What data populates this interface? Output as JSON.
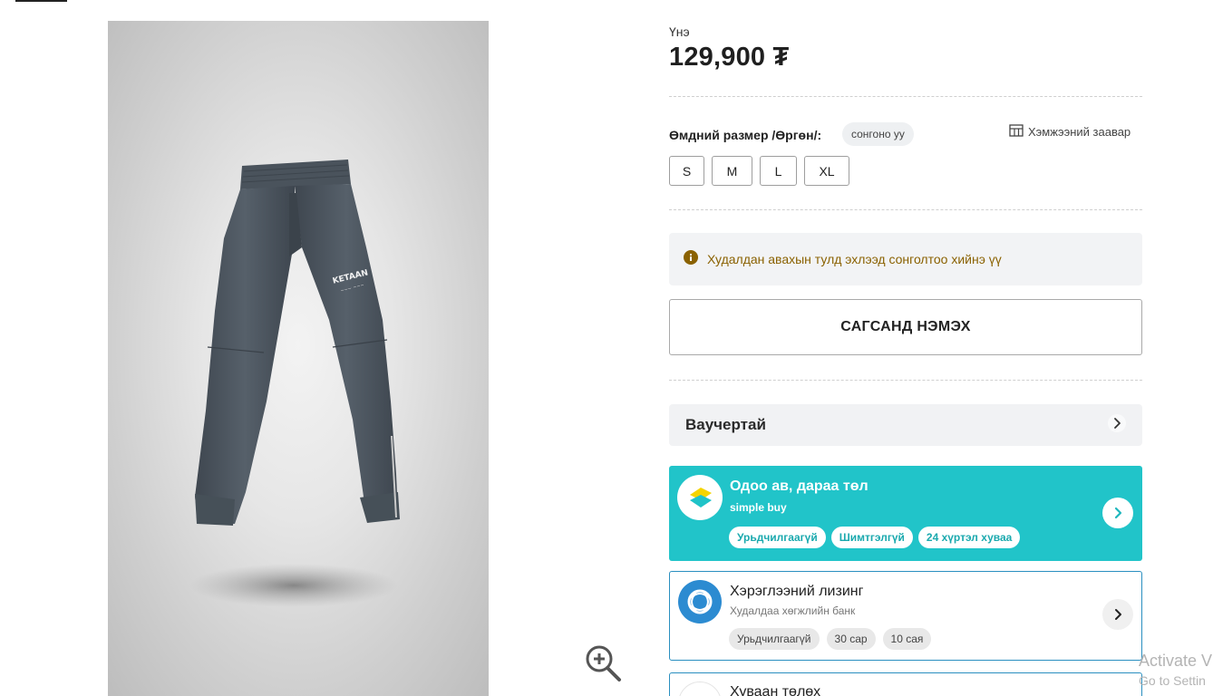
{
  "product": {
    "image_alt": "Гар цамцны өмд",
    "print_text": "KETAAN"
  },
  "price": {
    "label": "Үнэ",
    "value": "129,900 ₮"
  },
  "size": {
    "label": "Өмдний размер /Өргөн/:",
    "chip": "сонгоно уу",
    "guide_label": "Хэмжээний заавар",
    "guide_icon": "table-icon",
    "options": [
      "S",
      "M",
      "L",
      "XL"
    ]
  },
  "notice": {
    "icon": "info-icon",
    "text": "Худалдан авахын тулд эхлээд сонголтоо хийнэ үү",
    "color": "#8a6100"
  },
  "cart_button": {
    "label": "САГСАНД НЭМЭХ"
  },
  "voucher": {
    "label": "Ваучертай",
    "icon": "chevron-right-icon"
  },
  "simple_buy": {
    "title": "Одоо ав, дараа төл",
    "subtitle": "simple buy",
    "tags": [
      "Урьдчилгаагүй",
      "Шимтгэлгүй",
      "24 хүртэл хуваа"
    ],
    "color": "#21c4c9"
  },
  "leasing": {
    "title": "Хэрэглээний лизинг",
    "subtitle": "Худалдаа хөгжлийн банк",
    "tags": [
      "Урьдчилгаагүй",
      "30 сар",
      "10 сая"
    ]
  },
  "installment": {
    "title": "Хуваан төлөх"
  },
  "watermark": {
    "line1": "Activate V",
    "line2": "Go to Settin"
  },
  "icons": {
    "zoom": "zoom-in-icon"
  }
}
